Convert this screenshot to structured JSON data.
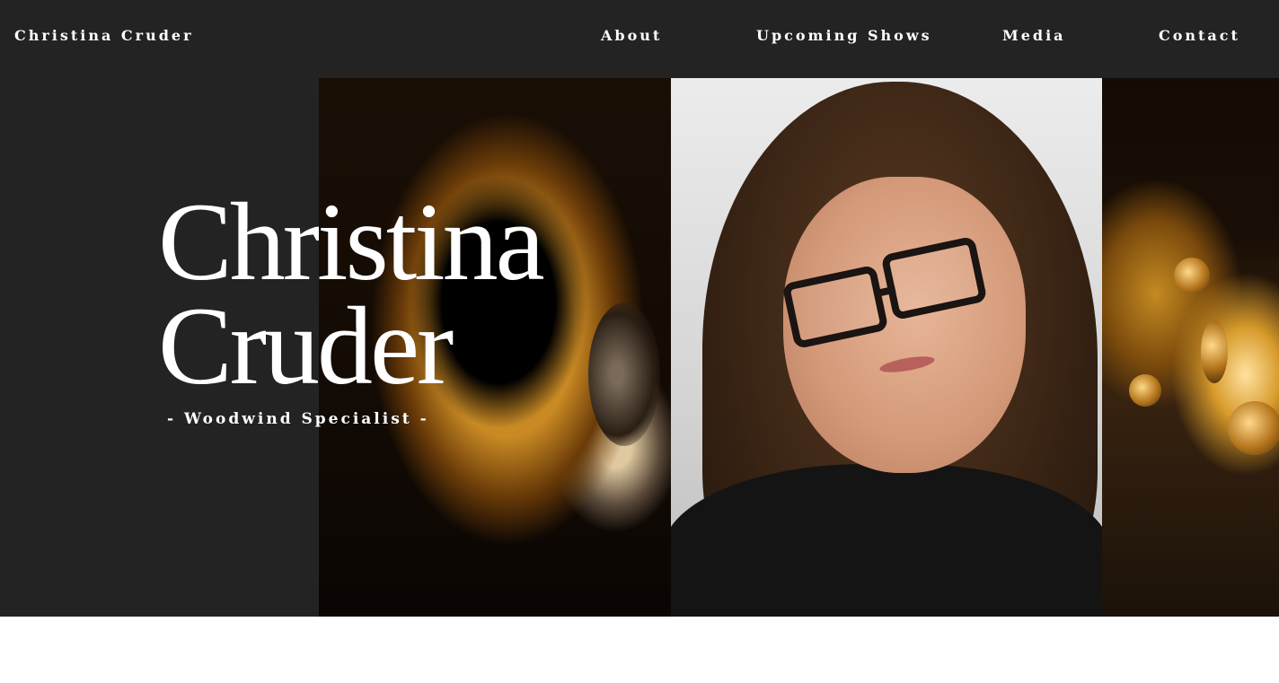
{
  "nav": {
    "brand": "Christina Cruder",
    "links": [
      {
        "label": "About"
      },
      {
        "label": "Upcoming Shows"
      },
      {
        "label": "Media"
      },
      {
        "label": "Contact"
      }
    ]
  },
  "hero": {
    "title_line1": "Christina",
    "title_line2": "Cruder",
    "subtitle": "- Woodwind Specialist -"
  },
  "colors": {
    "nav_bg": "#232323",
    "hero_bg": "#232323",
    "text": "#ffffff"
  }
}
